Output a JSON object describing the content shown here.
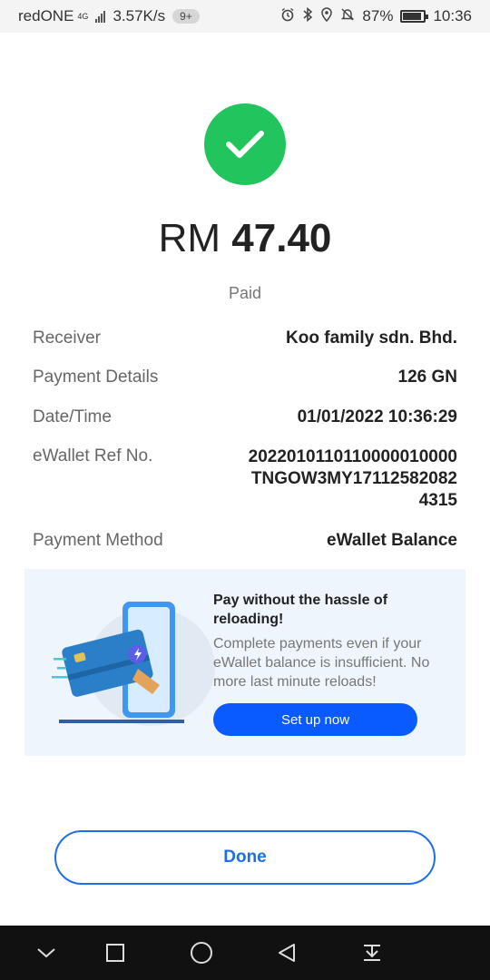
{
  "status_bar": {
    "carrier": "redONE",
    "network_tag": "4G",
    "speed": "3.57K/s",
    "notification_badge": "9+",
    "battery_percent": "87%",
    "time": "10:36",
    "icons": [
      "alarm-icon",
      "bluetooth-icon",
      "location-icon",
      "mute-icon",
      "battery-icon"
    ]
  },
  "payment": {
    "currency": "RM",
    "amount": "47.40",
    "status": "Paid",
    "details": [
      {
        "label": "Receiver",
        "value": "Koo family sdn. Bhd."
      },
      {
        "label": "Payment Details",
        "value": "126 GN"
      },
      {
        "label": "Date/Time",
        "value": "01/01/2022 10:36:29"
      },
      {
        "label": "eWallet Ref No.",
        "value": "2022010110110000010000TNGOW3MY171125820824315"
      },
      {
        "label": "Payment Method",
        "value": "eWallet Balance"
      }
    ]
  },
  "promo": {
    "title": "Pay without the hassle of reloading!",
    "description": "Complete payments even if your eWallet balance is insufficient. No more last minute reloads!",
    "button_label": "Set up now"
  },
  "done_label": "Done",
  "colors": {
    "success_green": "#21c45d",
    "primary_blue": "#0a5bff",
    "done_blue": "#1e6ee8",
    "promo_bg": "#eef5fd"
  }
}
